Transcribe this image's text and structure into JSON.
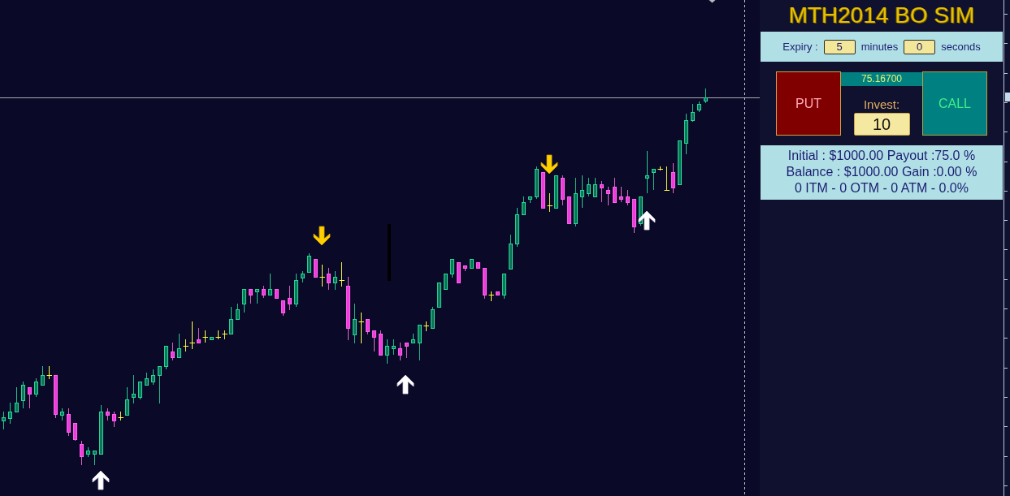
{
  "panel": {
    "title": "MTH2014 BO SIM",
    "expiry": {
      "label": "Expiry :",
      "minutes": {
        "value": "5",
        "unit": "minutes"
      },
      "seconds": {
        "value": "0",
        "unit": "seconds"
      }
    },
    "trade": {
      "put_button": "PUT",
      "price": "75.16700",
      "invest_label": "Invest:",
      "invest_value": "10",
      "call_button": "CALL"
    },
    "summary": [
      "Initial : $1000.00 Payout :75.0 %",
      "Balance : $1000.00 Gain :0.00 %",
      "0 ITM - 0 OTM - 0 ATM - 0.0%"
    ]
  }
}
